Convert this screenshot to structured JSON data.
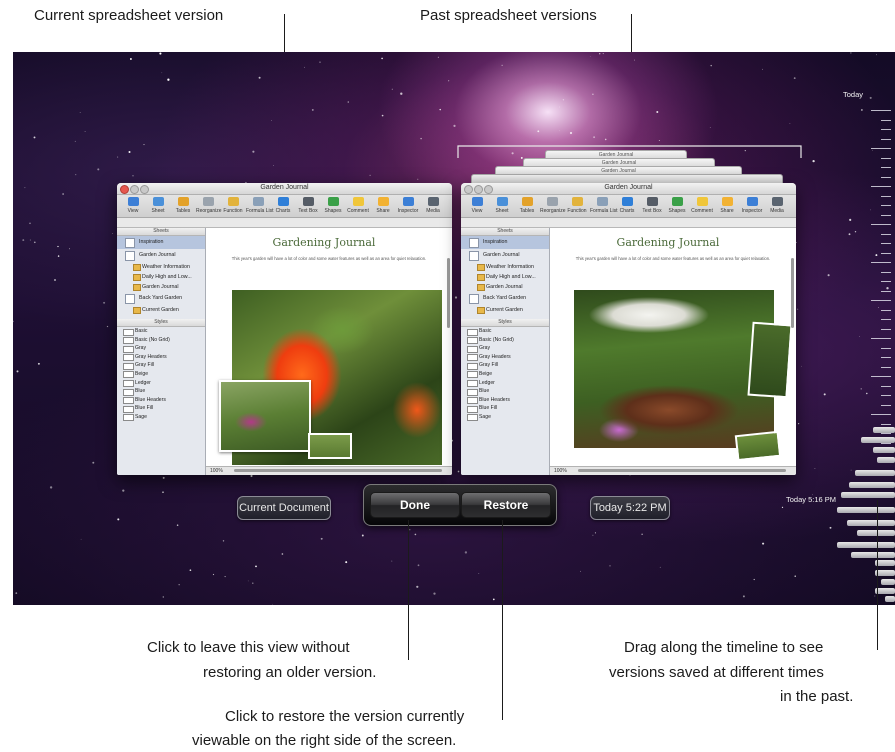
{
  "callouts": {
    "current_version": "Current spreadsheet version",
    "past_versions": "Past spreadsheet versions",
    "done_line1": "Click to leave this view without",
    "done_line2": "restoring an older version.",
    "restore_line1": "Click to restore the version currently",
    "restore_line2": "viewable on the right side of the screen.",
    "timeline_line1": "Drag along the timeline to see",
    "timeline_line2": "versions saved at different times",
    "timeline_line3": "in the past."
  },
  "window": {
    "title": "Garden Journal",
    "toolbar": [
      {
        "label": "View",
        "color": "#3d7fd6"
      },
      {
        "label": "Sheet",
        "color": "#4a90d9"
      },
      {
        "label": "Tables",
        "color": "#e3a22a"
      },
      {
        "label": "Reorganize",
        "color": "#9aa3ad"
      },
      {
        "label": "Function",
        "color": "#e2b33c"
      },
      {
        "label": "Formula List",
        "color": "#8aa0b8"
      },
      {
        "label": "Charts",
        "color": "#2f7fd8"
      },
      {
        "label": "Text Box",
        "color": "#555c66"
      },
      {
        "label": "Shapes",
        "color": "#3aa048"
      },
      {
        "label": "Comment",
        "color": "#f0c63a"
      },
      {
        "label": "Share",
        "color": "#f2b233"
      },
      {
        "label": "Inspector",
        "color": "#3c7fd6"
      },
      {
        "label": "Media",
        "color": "#5a6470"
      }
    ],
    "sheets_header": "Sheets",
    "sheets": [
      {
        "label": "Inspiration",
        "selected": true
      },
      {
        "label": "Garden Journal",
        "children": [
          "Weather Information",
          "Daily High and Low...",
          "Garden Journal"
        ]
      },
      {
        "label": "Back Yard Garden",
        "children": [
          "Current Garden"
        ]
      }
    ],
    "styles_header": "Styles",
    "styles": [
      "Basic",
      "Basic (No Grid)",
      "Gray",
      "Gray Headers",
      "Gray Fill",
      "Beige",
      "Ledger",
      "Blue",
      "Blue Headers",
      "Blue Fill",
      "Sage"
    ],
    "doc_title": "Gardening Journal",
    "doc_subtitle": "This year's garden will have a lot of color and some water features as well as an area for quiet relaxation.",
    "zoom": "100%"
  },
  "stacked_titles": [
    "Garden Journal",
    "Garden Journal",
    "Garden Journal"
  ],
  "labels": {
    "current_document": "Current Document",
    "past_time": "Today 5:22 PM",
    "done": "Done",
    "restore": "Restore"
  },
  "timeline": {
    "top_label": "Today",
    "marker_label": "Today 5:16 PM"
  },
  "colors": {
    "accent_red": "#e6574e",
    "selection": "#b6c5de",
    "title_green": "#4b6a3a"
  }
}
